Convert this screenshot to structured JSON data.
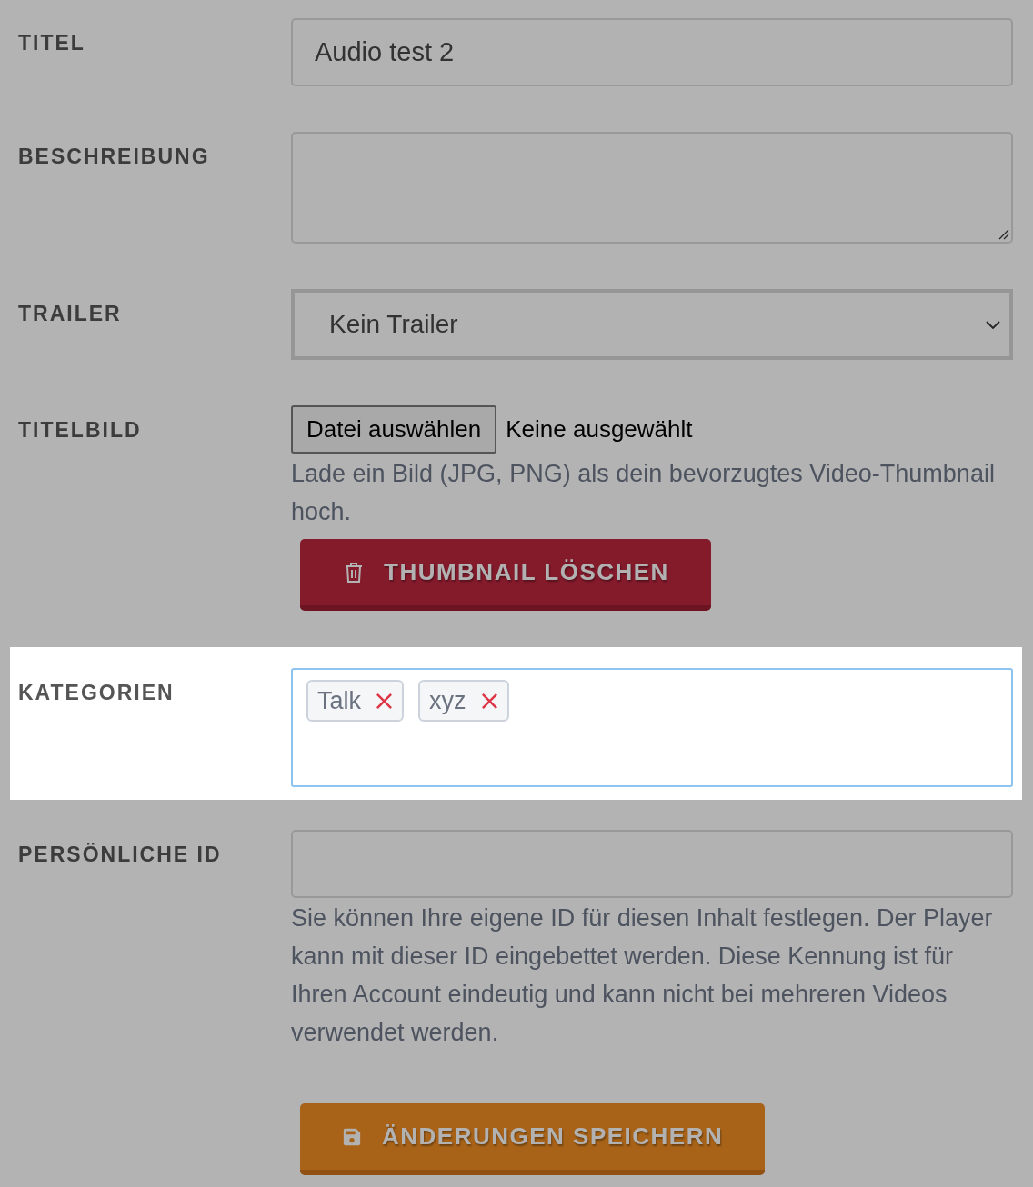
{
  "fields": [
    {
      "kind": "text",
      "label": "TITEL",
      "value": "Audio test 2",
      "highlighted": false
    },
    {
      "kind": "textarea",
      "label": "BESCHREIBUNG",
      "highlighted": false
    },
    {
      "kind": "select",
      "label": "TRAILER",
      "value": "Kein Trailer",
      "highlighted": false
    },
    {
      "kind": "file",
      "label": "TITELBILD",
      "button": "Datei auswählen",
      "status": "Keine ausgewählt",
      "help": "Lade ein Bild (JPG, PNG) als dein bevorzugtes Video-Thumbnail hoch.",
      "action": "THUMBNAIL LÖSCHEN",
      "highlighted": false
    },
    {
      "kind": "tags",
      "label": "KATEGORIEN",
      "tags": [
        {
          "label": "Talk"
        },
        {
          "label": "xyz"
        }
      ],
      "highlighted": true
    },
    {
      "kind": "text",
      "label": "PERSÖNLICHE ID",
      "help": "Sie können Ihre eigene ID für diesen Inhalt festlegen. Der Player kann mit dieser ID eingebettet werden. Diese Kennung ist für Ihren Account eindeutig und kann nicht bei mehreren Videos verwendet werden.",
      "highlighted": false
    }
  ],
  "submit": {
    "label": "ÄNDERUNGEN SPEICHERN",
    "highlighted": false
  }
}
